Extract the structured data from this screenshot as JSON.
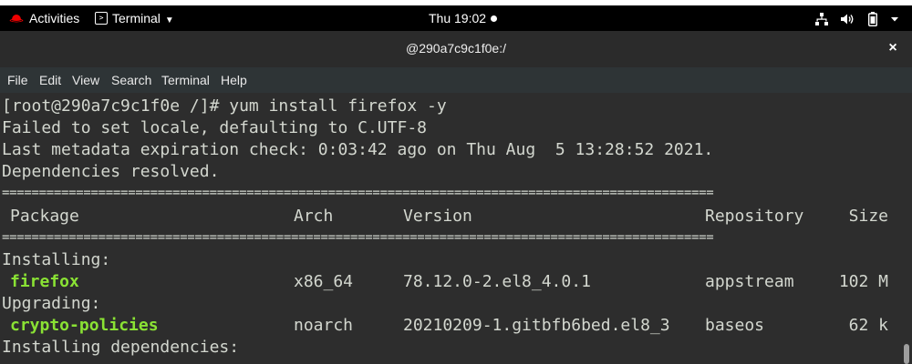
{
  "topbar": {
    "activities": "Activities",
    "app_name": "Terminal",
    "clock": "Thu 19:02"
  },
  "window": {
    "title": "@290a7c9c1f0e:/",
    "close": "×"
  },
  "menu": {
    "file": "File",
    "edit": "Edit",
    "view": "View",
    "search": "Search",
    "terminal": "Terminal",
    "help": "Help"
  },
  "terminal": {
    "prompt_line": "[root@290a7c9c1f0e /]# yum install firefox -y",
    "line1": "Failed to set locale, defaulting to C.UTF-8",
    "line2": "Last metadata expiration check: 0:03:42 ago on Thu Aug  5 13:28:52 2021.",
    "line3": "Dependencies resolved.",
    "separator": "================================================================================================",
    "headers": {
      "package": "Package",
      "arch": "Arch",
      "version": "Version",
      "repository": "Repository",
      "size": "Size"
    },
    "section_installing": "Installing:",
    "section_upgrading": "Upgrading:",
    "section_deps": "Installing dependencies:",
    "rows": [
      {
        "package": "firefox",
        "arch": "x86_64",
        "version": "78.12.0-2.el8_4.0.1",
        "repository": "appstream",
        "size": "102 M"
      },
      {
        "package": "crypto-policies",
        "arch": "noarch",
        "version": "20210209-1.gitbfb6bed.el8_3",
        "repository": "baseos",
        "size": "62 k"
      }
    ]
  }
}
